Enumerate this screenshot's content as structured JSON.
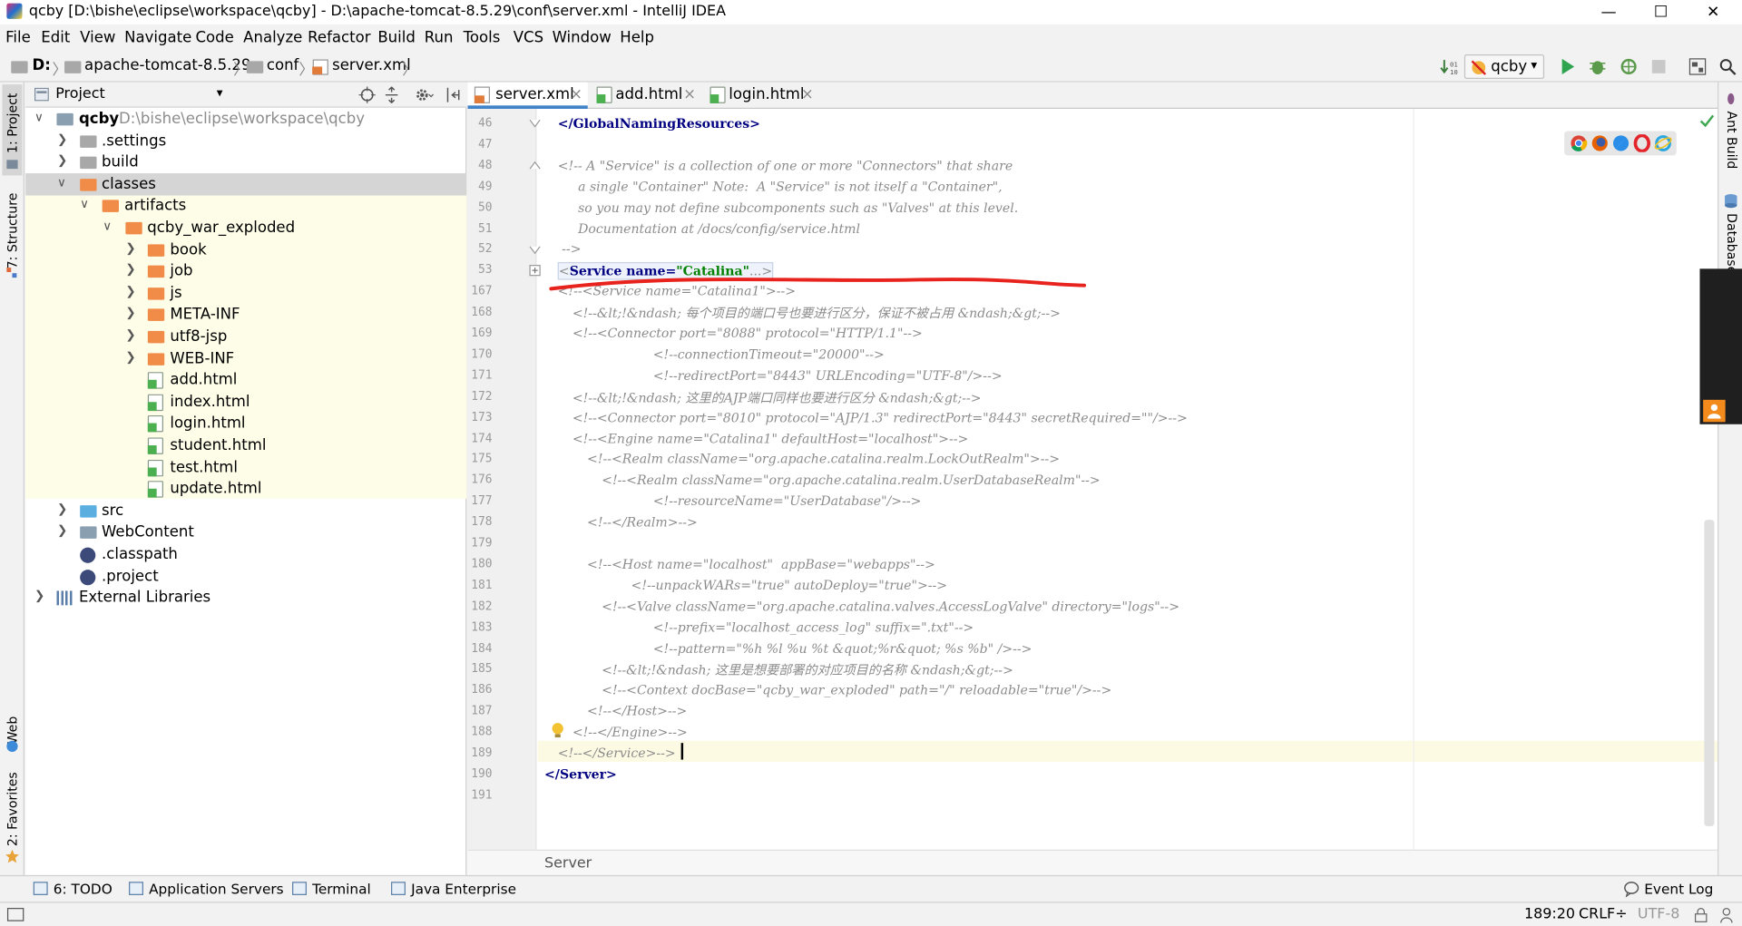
{
  "window": {
    "title": "qcby [D:\\bishe\\eclipse\\workspace\\qcby] - D:\\apache-tomcat-8.5.29\\conf\\server.xml - IntelliJ IDEA",
    "min": "—",
    "max": "☐",
    "close": "✕"
  },
  "menu": [
    "File",
    "Edit",
    "View",
    "Navigate",
    "Code",
    "Analyze",
    "Refactor",
    "Build",
    "Run",
    "Tools",
    "VCS",
    "Window",
    "Help"
  ],
  "breadcrumb": {
    "drive": "D:",
    "dir1": "apache-tomcat-8.5.29",
    "dir2": "conf",
    "file": "server.xml",
    "sep": "〉"
  },
  "toolbar": {
    "run_config": "qcby",
    "dropdown_caret": "▾"
  },
  "left_strip": {
    "project": "1: Project",
    "structure": "7: Structure",
    "web": "Web",
    "favorites": "2: Favorites"
  },
  "right_strip": {
    "ant": "Ant Build",
    "database": "Database"
  },
  "project_panel": {
    "title": "Project",
    "caret": "▾"
  },
  "tree": [
    {
      "label": "qcby",
      "path": "D:\\bishe\\eclipse\\workspace\\qcby",
      "indent": 0,
      "arrow": "∨",
      "icon": "module"
    },
    {
      "label": ".settings",
      "indent": 1,
      "arrow": "❯",
      "icon": "folder"
    },
    {
      "label": "build",
      "indent": 1,
      "arrow": "❯",
      "icon": "folder"
    },
    {
      "label": "classes",
      "indent": 1,
      "arrow": "∨",
      "icon": "folder-orange"
    },
    {
      "label": "artifacts",
      "indent": 2,
      "arrow": "∨",
      "icon": "folder-orange"
    },
    {
      "label": "qcby_war_exploded",
      "indent": 3,
      "arrow": "∨",
      "icon": "folder-orange"
    },
    {
      "label": "book",
      "indent": 4,
      "arrow": "❯",
      "icon": "folder-orange"
    },
    {
      "label": "job",
      "indent": 4,
      "arrow": "❯",
      "icon": "folder-orange"
    },
    {
      "label": "js",
      "indent": 4,
      "arrow": "❯",
      "icon": "folder-orange"
    },
    {
      "label": "META-INF",
      "indent": 4,
      "arrow": "❯",
      "icon": "folder-orange"
    },
    {
      "label": "utf8-jsp",
      "indent": 4,
      "arrow": "❯",
      "icon": "folder-orange"
    },
    {
      "label": "WEB-INF",
      "indent": 4,
      "arrow": "❯",
      "icon": "folder-orange"
    },
    {
      "label": "add.html",
      "indent": 4,
      "arrow": "",
      "icon": "html"
    },
    {
      "label": "index.html",
      "indent": 4,
      "arrow": "",
      "icon": "html"
    },
    {
      "label": "login.html",
      "indent": 4,
      "arrow": "",
      "icon": "html"
    },
    {
      "label": "student.html",
      "indent": 4,
      "arrow": "",
      "icon": "html"
    },
    {
      "label": "test.html",
      "indent": 4,
      "arrow": "",
      "icon": "html"
    },
    {
      "label": "update.html",
      "indent": 4,
      "arrow": "",
      "icon": "html"
    },
    {
      "label": "src",
      "indent": 1,
      "arrow": "❯",
      "icon": "folder-blue"
    },
    {
      "label": "WebContent",
      "indent": 1,
      "arrow": "❯",
      "icon": "folder-web"
    },
    {
      "label": ".classpath",
      "indent": 1,
      "arrow": "",
      "icon": "eclipse"
    },
    {
      "label": ".project",
      "indent": 1,
      "arrow": "",
      "icon": "eclipse"
    },
    {
      "label": "External Libraries",
      "indent": 0,
      "arrow": "❯",
      "icon": "libraries"
    }
  ],
  "tabs": [
    {
      "label": "server.xml",
      "active": true,
      "icon": "xml"
    },
    {
      "label": "add.html",
      "active": false,
      "icon": "html"
    },
    {
      "label": "login.html",
      "active": false,
      "icon": "html"
    }
  ],
  "tab_close": "×",
  "code_lines": [
    {
      "n": "46",
      "text": "</GlobalNamingResources>",
      "kind": "tag",
      "indent": 0
    },
    {
      "n": "47",
      "text": "",
      "kind": "comment",
      "indent": 0
    },
    {
      "n": "48",
      "text": "<!-- A \"Service\" is a collection of one or more \"Connectors\" that share",
      "kind": "comment",
      "indent": 0
    },
    {
      "n": "49",
      "text": "     a single \"Container\" Note:  A \"Service\" is not itself a \"Container\",",
      "kind": "comment",
      "indent": 0
    },
    {
      "n": "50",
      "text": "     so you may not define subcomponents such as \"Valves\" at this level.",
      "kind": "comment",
      "indent": 0
    },
    {
      "n": "51",
      "text": "     Documentation at /docs/config/service.html",
      "kind": "comment",
      "indent": 0
    },
    {
      "n": "52",
      "text": " -->",
      "kind": "comment",
      "indent": 0
    },
    {
      "n": "53",
      "text": "<Service name=\"Catalina\"...>",
      "kind": "folded",
      "indent": 0
    },
    {
      "n": "167",
      "text": "<!--<Service name=\"Catalina1\">-->",
      "kind": "comment",
      "indent": 0
    },
    {
      "n": "168",
      "text": "<!--&lt;!&ndash; 每个项目的端口号也要进行区分，保证不被占用 &ndash;&gt;-->",
      "kind": "comment",
      "indent": 2
    },
    {
      "n": "169",
      "text": "<!--<Connector port=\"8088\" protocol=\"HTTP/1.1\"-->",
      "kind": "comment",
      "indent": 2
    },
    {
      "n": "170",
      "text": "<!--connectionTimeout=\"20000\"-->",
      "kind": "comment",
      "indent": 13
    },
    {
      "n": "171",
      "text": "<!--redirectPort=\"8443\" URLEncoding=\"UTF-8\"/>-->",
      "kind": "comment",
      "indent": 13
    },
    {
      "n": "172",
      "text": "<!--&lt;!&ndash; 这里的AJP端口同样也要进行区分 &ndash;&gt;-->",
      "kind": "comment",
      "indent": 2
    },
    {
      "n": "173",
      "text": "<!--<Connector port=\"8010\" protocol=\"AJP/1.3\" redirectPort=\"8443\" secretRequired=\"\"/>-->",
      "kind": "comment",
      "indent": 2
    },
    {
      "n": "174",
      "text": "<!--<Engine name=\"Catalina1\" defaultHost=\"localhost\">-->",
      "kind": "comment",
      "indent": 2
    },
    {
      "n": "175",
      "text": "<!--<Realm className=\"org.apache.catalina.realm.LockOutRealm\">-->",
      "kind": "comment",
      "indent": 4
    },
    {
      "n": "176",
      "text": "<!--<Realm className=\"org.apache.catalina.realm.UserDatabaseRealm\"-->",
      "kind": "comment",
      "indent": 6
    },
    {
      "n": "177",
      "text": "<!--resourceName=\"UserDatabase\"/>-->",
      "kind": "comment",
      "indent": 13
    },
    {
      "n": "178",
      "text": "<!--</Realm>-->",
      "kind": "comment",
      "indent": 4
    },
    {
      "n": "179",
      "text": "",
      "kind": "comment",
      "indent": 0
    },
    {
      "n": "180",
      "text": "<!--<Host name=\"localhost\"  appBase=\"webapps\"-->",
      "kind": "comment",
      "indent": 4
    },
    {
      "n": "181",
      "text": "<!--unpackWARs=\"true\" autoDeploy=\"true\">-->",
      "kind": "comment",
      "indent": 10
    },
    {
      "n": "182",
      "text": "<!--<Valve className=\"org.apache.catalina.valves.AccessLogValve\" directory=\"logs\"-->",
      "kind": "comment",
      "indent": 6
    },
    {
      "n": "183",
      "text": "<!--prefix=\"localhost_access_log\" suffix=\".txt\"-->",
      "kind": "comment",
      "indent": 13
    },
    {
      "n": "184",
      "text": "<!--pattern=\"%h %l %u %t &quot;%r&quot; %s %b\" />-->",
      "kind": "comment",
      "indent": 13
    },
    {
      "n": "185",
      "text": "<!--&lt;!&ndash; 这里是想要部署的对应项目的名称 &ndash;&gt;-->",
      "kind": "comment",
      "indent": 6
    },
    {
      "n": "186",
      "text": "<!--<Context docBase=\"qcby_war_exploded\" path=\"/\" reloadable=\"true\"/>-->",
      "kind": "comment",
      "indent": 6
    },
    {
      "n": "187",
      "text": "<!--</Host>-->",
      "kind": "comment",
      "indent": 4
    },
    {
      "n": "188",
      "text": "<!--</Engine>-->",
      "kind": "comment",
      "indent": 2
    },
    {
      "n": "189",
      "text": "<!--</Service>-->",
      "kind": "comment",
      "indent": 0
    },
    {
      "n": "190",
      "text": "</Server>",
      "kind": "tag",
      "indent": 0
    },
    {
      "n": "191",
      "text": "",
      "kind": "comment",
      "indent": 0
    }
  ],
  "folded": {
    "open": "<",
    "tag": "Service",
    "attr": " name=",
    "val": "\"Catalina\"",
    "rest": "...>"
  },
  "editor_breadcrumb": "Server",
  "bottom_tabs": [
    {
      "label": "6: TODO",
      "icon": "todo-icon"
    },
    {
      "label": "Application Servers",
      "icon": "server-icon"
    },
    {
      "label": "Terminal",
      "icon": "terminal-icon"
    },
    {
      "label": "Java Enterprise",
      "icon": "java-ee-icon"
    }
  ],
  "event_log": "Event Log",
  "status": {
    "position": "189:20",
    "line_sep": "CRLF÷",
    "encoding": "UTF-8"
  },
  "colors": {
    "active_tab_underline": "#4083c9",
    "selection": "#d5d5d5",
    "annotation_red": "#e8221c"
  }
}
